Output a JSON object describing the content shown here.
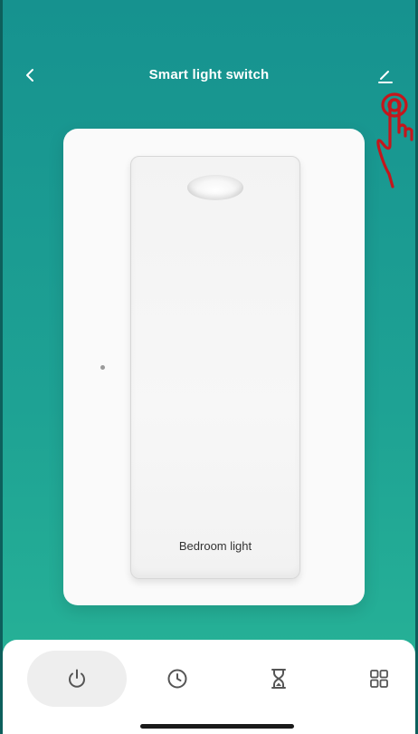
{
  "header": {
    "title": "Smart light switch",
    "back_icon": "chevron-left-icon",
    "edit_icon": "pencil-icon"
  },
  "switch": {
    "label": "Bedroom light"
  },
  "bottom_nav": {
    "tabs": [
      {
        "icon": "power-icon",
        "active": true
      },
      {
        "icon": "clock-icon",
        "active": false
      },
      {
        "icon": "hourglass-icon",
        "active": false
      },
      {
        "icon": "grid-icon",
        "active": false
      }
    ]
  },
  "colors": {
    "background_top": "#16928f",
    "background_bottom": "#28b597",
    "hand_annotation": "#c4161c"
  }
}
